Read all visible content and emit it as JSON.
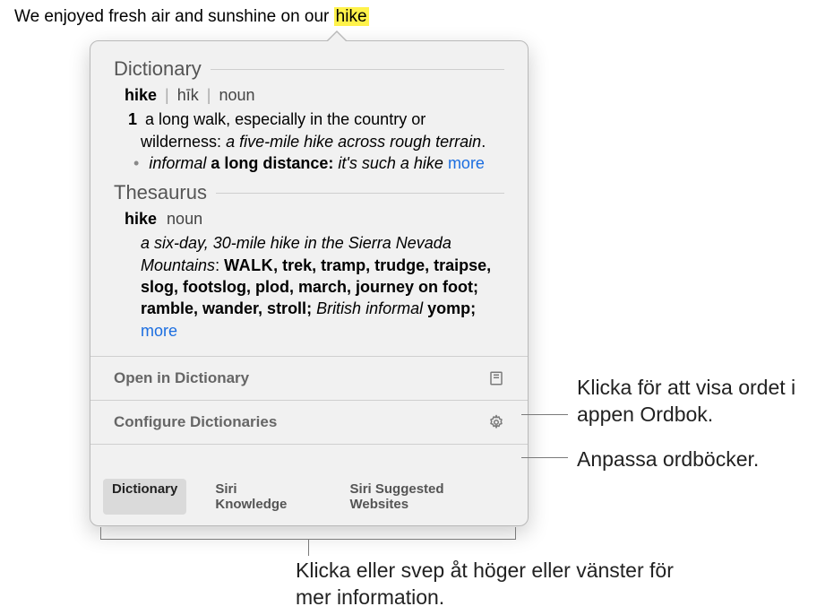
{
  "sentence_prefix": "We enjoyed fresh air and sunshine on our ",
  "highlighted_word": "hike",
  "dictionary": {
    "section_title": "Dictionary",
    "headword": "hike",
    "pronunciation": "hīk",
    "pos": "noun",
    "sense_number": "1",
    "definition": "a long walk, especially in the country or wilderness:",
    "example": "a five-mile hike across rough terrain",
    "example_period": ".",
    "sub_label": "informal",
    "sub_def": "a long distance:",
    "sub_example": "it's such a hike",
    "more": "more"
  },
  "thesaurus": {
    "section_title": "Thesaurus",
    "headword": "hike",
    "pos": "noun",
    "example": "a six-day, 30-mile hike in the Sierra Nevada Mountains",
    "colon": ": ",
    "synonym_head": "WALK",
    "synonyms_rest": ", trek, tramp, trudge, traipse, slog, footslog, plod, march, journey on foot; ramble, wander, stroll; ",
    "reg_label": "British informal",
    "reg_syn": " yomp; ",
    "more": "more"
  },
  "actions": {
    "open": "Open in Dictionary",
    "configure": "Configure Dictionaries"
  },
  "tabs": {
    "dictionary": "Dictionary",
    "siri_knowledge": "Siri Knowledge",
    "siri_websites": "Siri Suggested Websites"
  },
  "callouts": {
    "open_label": "Klicka för att visa ordet i appen Ordbok.",
    "configure_label": "Anpassa ordböcker.",
    "tabs_label": "Klicka eller svep åt höger eller vänster för mer information."
  }
}
